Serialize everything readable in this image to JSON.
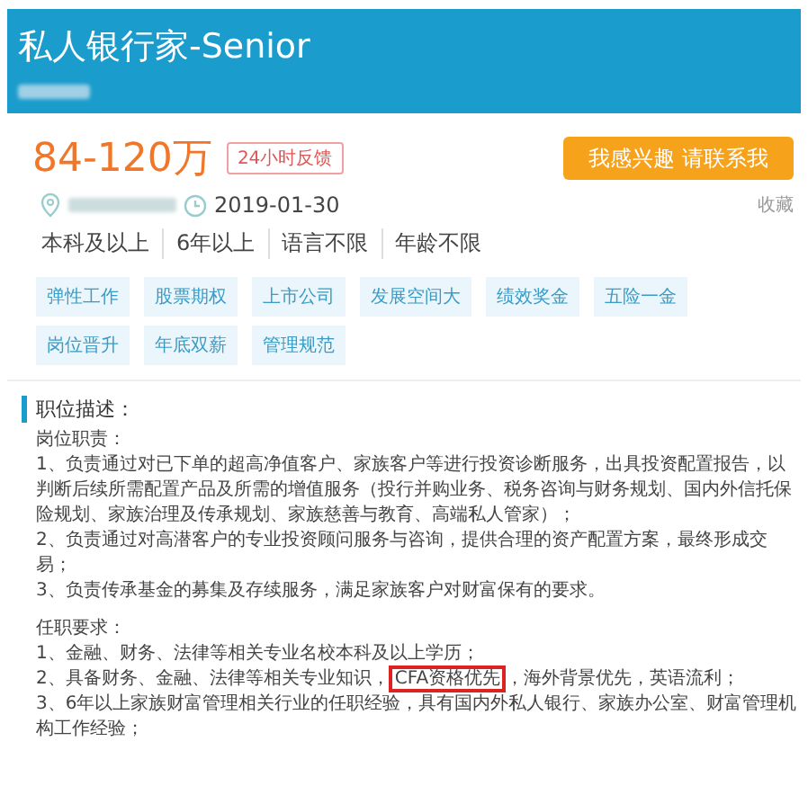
{
  "header": {
    "title": "私人银行家-Senior",
    "company_redacted": true
  },
  "salary": {
    "amount": "84-120万",
    "badge": "24小时反馈"
  },
  "apply_button": "我感兴趣 请联系我",
  "meta": {
    "location_redacted": true,
    "date": "2019-01-30",
    "favorite": "收藏"
  },
  "requirements": [
    "本科及以上",
    "6年以上",
    "语言不限",
    "年龄不限"
  ],
  "tags": [
    "弹性工作",
    "股票期权",
    "上市公司",
    "发展空间大",
    "绩效奖金",
    "五险一金",
    "岗位晋升",
    "年底双薪",
    "管理规范"
  ],
  "description": {
    "heading": "职位描述：",
    "blocks": [
      {
        "kind": "heading",
        "text": "岗位职责："
      },
      {
        "kind": "line",
        "text": "1、负责通过对已下单的超高净值客户、家族客户等进行投资诊断服务，出具投资配置报告，以判断后续所需配置产品及所需的增值服务（投行并购业务、税务咨询与财务规划、国内外信托保险规划、家族治理及传承规划、家族慈善与教育、高端私人管家）；"
      },
      {
        "kind": "line",
        "text": "2、负责通过对高潜客户的专业投资顾问服务与咨询，提供合理的资产配置方案，最终形成交易；"
      },
      {
        "kind": "line",
        "text": "3、负责传承基金的募集及存续服务，满足家族客户对财富保有的要求。"
      },
      {
        "kind": "gap"
      },
      {
        "kind": "heading",
        "text": "任职要求："
      },
      {
        "kind": "line",
        "text": "1、金融、财务、法律等相关专业名校本科及以上学历；"
      },
      {
        "kind": "marked",
        "before": "2、具备财务、金融、法律等相关专业知识，",
        "mark": "CFA资格优先",
        "after": "，海外背景优先，英语流利；"
      },
      {
        "kind": "line",
        "text": "3、6年以上家族财富管理相关行业的任职经验，具有国内外私人银行、家族办公室、财富管理机构工作经验；"
      }
    ]
  }
}
